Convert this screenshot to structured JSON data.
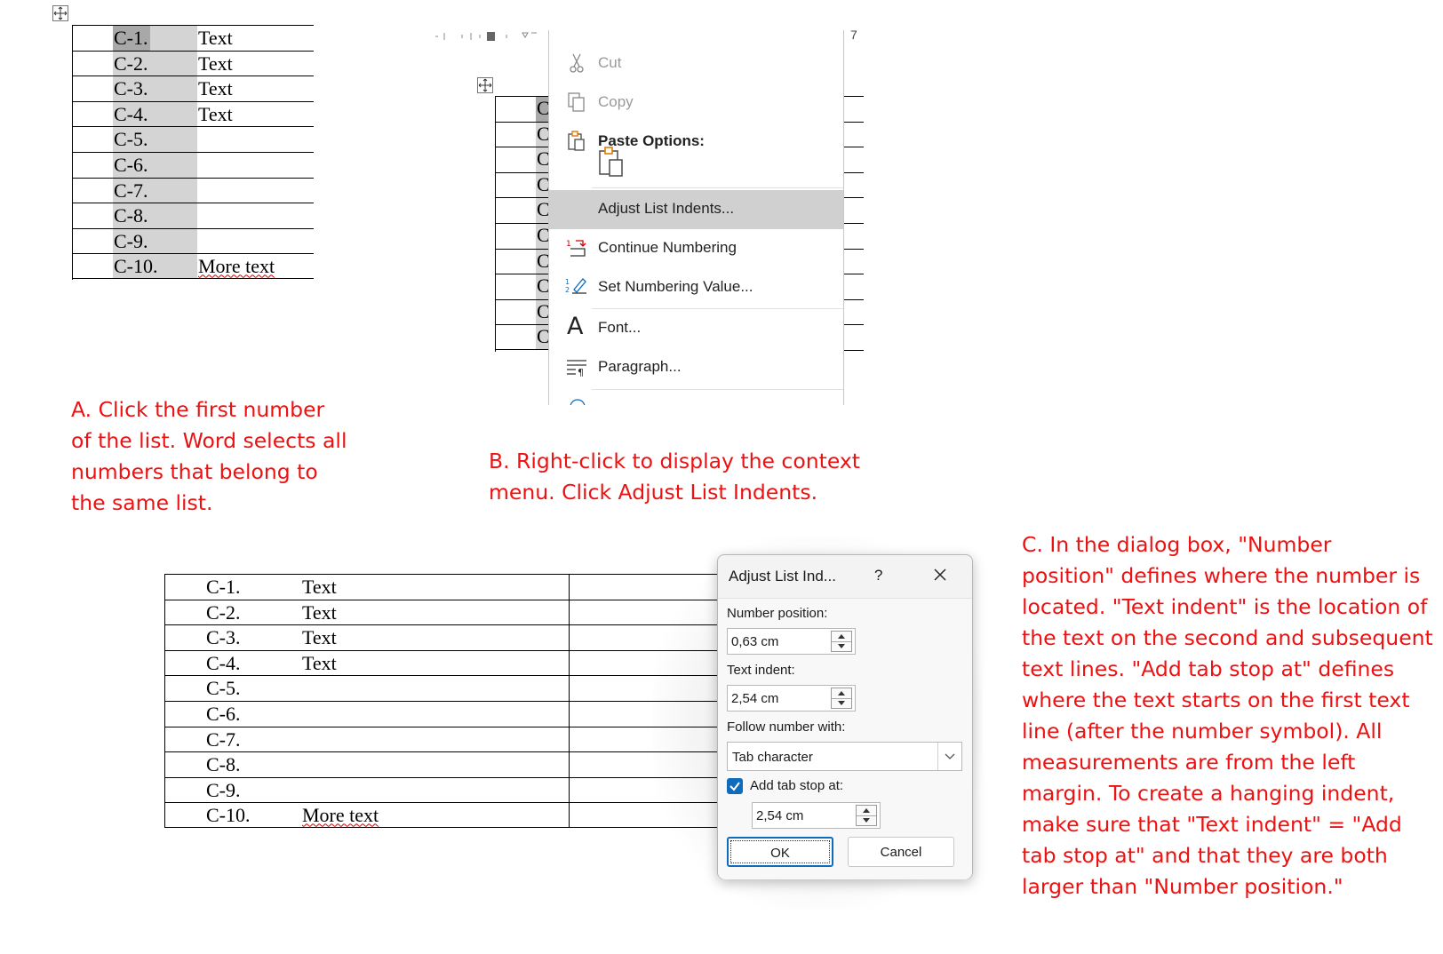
{
  "panel_a": {
    "rows": [
      {
        "num": "C-1.",
        "text": "Text"
      },
      {
        "num": "C-2.",
        "text": "Text"
      },
      {
        "num": "C-3.",
        "text": "Text"
      },
      {
        "num": "C-4.",
        "text": "Text"
      },
      {
        "num": "C-5.",
        "text": ""
      },
      {
        "num": "C-6.",
        "text": ""
      },
      {
        "num": "C-7.",
        "text": ""
      },
      {
        "num": "C-8.",
        "text": ""
      },
      {
        "num": "C-9.",
        "text": ""
      },
      {
        "num": "C-10.",
        "text": "More text"
      }
    ],
    "caption": "A. Click the first number\nof the list. Word selects all\nnumbers that belong to\nthe same list."
  },
  "panel_b": {
    "table_letter": "C",
    "ruler_number": "7",
    "menu": {
      "cut": "Cut",
      "copy": "Copy",
      "paste_options": "Paste Options:",
      "adjust_list_indents": "Adjust List Indents...",
      "continue_numbering": "Continue Numbering",
      "set_numbering_value": "Set Numbering Value...",
      "font": "Font...",
      "paragraph": "Paragraph..."
    },
    "caption": "B. Right-click to display the context\nmenu. Click Adjust List Indents."
  },
  "panel_c": {
    "rows": [
      {
        "num": "C-1.",
        "text": "Text"
      },
      {
        "num": "C-2.",
        "text": "Text"
      },
      {
        "num": "C-3.",
        "text": "Text"
      },
      {
        "num": "C-4.",
        "text": "Text"
      },
      {
        "num": "C-5.",
        "text": ""
      },
      {
        "num": "C-6.",
        "text": ""
      },
      {
        "num": "C-7.",
        "text": ""
      },
      {
        "num": "C-8.",
        "text": ""
      },
      {
        "num": "C-9.",
        "text": ""
      },
      {
        "num": "C-10.",
        "text": "More text"
      }
    ],
    "dialog": {
      "title": "Adjust List Ind...",
      "help": "?",
      "number_position_label": "Number position:",
      "number_position_value": "0,63 cm",
      "text_indent_label": "Text indent:",
      "text_indent_value": "2,54 cm",
      "follow_number_label": "Follow number with:",
      "follow_number_value": "Tab character",
      "add_tab_stop_label": "Add tab stop at:",
      "add_tab_stop_checked": true,
      "add_tab_stop_value": "2,54 cm",
      "ok": "OK",
      "cancel": "Cancel"
    },
    "caption": "C. In the dialog box, \"Number\nposition\" defines where the number is\nlocated. \"Text indent\" is the location of\nthe text on the second and subsequent\ntext lines. \"Add tab stop at\" defines\nwhere the text starts on the first text\nline (after the number symbol). All\nmeasurements are from the left\nmargin. To create a hanging indent,\nmake sure that \"Text indent\" = \"Add\ntab stop at\" and that they are both\nlarger than \"Number position.\""
  },
  "colors": {
    "caption": "#ee1111",
    "selection": "#d4d4d4",
    "checkbox": "#0f6cbd",
    "paste_icon": "#e07b00"
  }
}
